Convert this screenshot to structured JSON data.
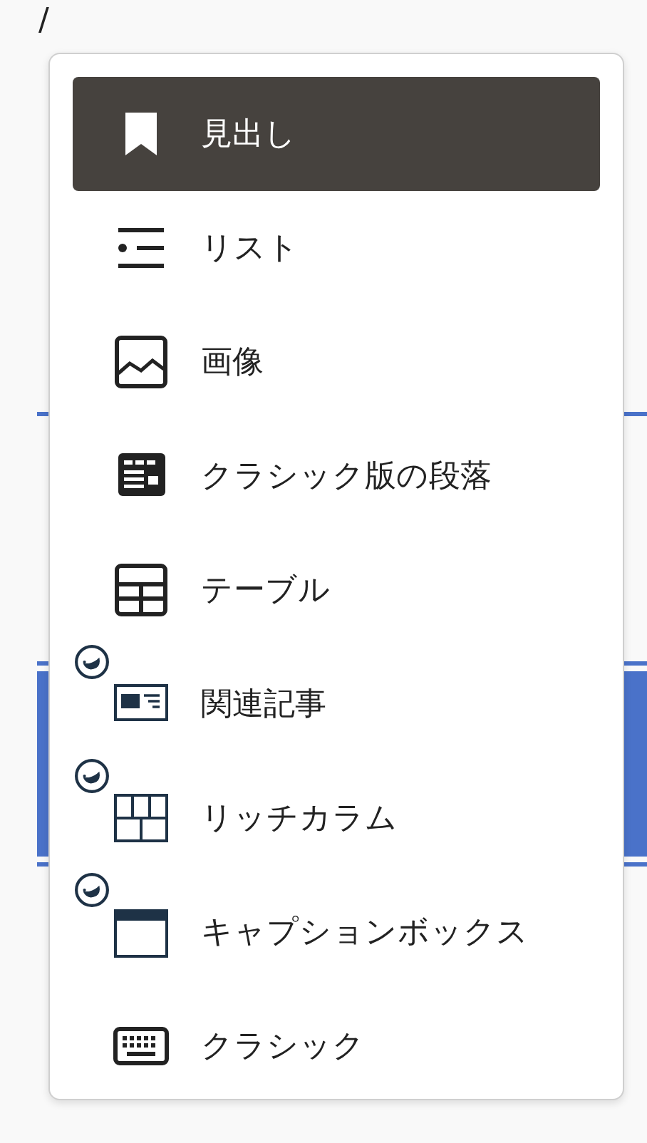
{
  "editor": {
    "typed_text": "/"
  },
  "inserter": {
    "items": [
      {
        "label": "見出し",
        "selected": true,
        "kind": "core"
      },
      {
        "label": "リスト",
        "selected": false,
        "kind": "core"
      },
      {
        "label": "画像",
        "selected": false,
        "kind": "core"
      },
      {
        "label": "クラシック版の段落",
        "selected": false,
        "kind": "core"
      },
      {
        "label": "テーブル",
        "selected": false,
        "kind": "core"
      },
      {
        "label": "関連記事",
        "selected": false,
        "kind": "plugin"
      },
      {
        "label": "リッチカラム",
        "selected": false,
        "kind": "plugin"
      },
      {
        "label": "キャプションボックス",
        "selected": false,
        "kind": "plugin"
      },
      {
        "label": "クラシック",
        "selected": false,
        "kind": "core"
      }
    ]
  }
}
